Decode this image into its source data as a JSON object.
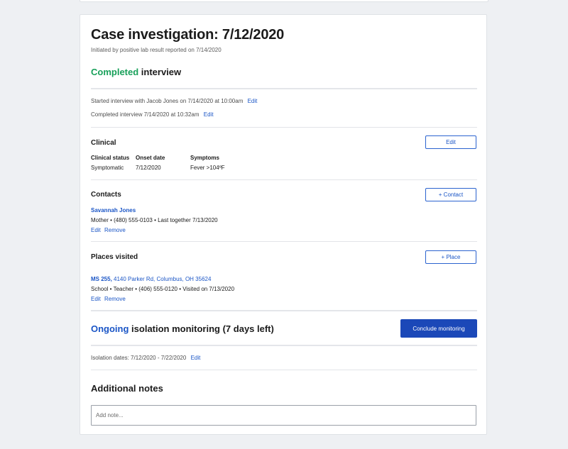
{
  "case": {
    "title": "Case investigation: 7/12/2020",
    "subtitle": "Initiated by positive lab result reported on 7/14/2020"
  },
  "interview": {
    "status_word": "Completed",
    "status_rest": " interview",
    "started_text": "Started interview with Jacob Jones on 7/14/2020 at 10:00am",
    "started_edit": "Edit",
    "completed_text": "Completed interview 7/14/2020 at 10:32am",
    "completed_edit": "Edit"
  },
  "clinical": {
    "heading": "Clinical",
    "edit_label": "Edit",
    "columns": [
      {
        "header": "Clinical status",
        "value": "Symptomatic"
      },
      {
        "header": "Onset date",
        "value": "7/12/2020"
      },
      {
        "header": "Symptoms",
        "value": "Fever >104ºF"
      }
    ]
  },
  "contacts": {
    "heading": "Contacts",
    "add_label": "+ Contact",
    "items": [
      {
        "name": "Savannah Jones",
        "details": "Mother • (480) 555-0103 • Last together 7/13/2020",
        "edit": "Edit",
        "remove": "Remove"
      }
    ]
  },
  "places": {
    "heading": "Places visited",
    "add_label": "+ Place",
    "items": [
      {
        "name": "MS 255,",
        "address": " 4140 Parker Rd, Columbus, OH 35624",
        "details": "School • Teacher • (406) 555-0120 • Visited on 7/13/2020",
        "edit": "Edit",
        "remove": "Remove"
      }
    ]
  },
  "monitoring": {
    "status_word": "Ongoing",
    "status_rest": " isolation monitoring (7 days left)",
    "conclude_label": "Conclude monitoring",
    "dates_text": "Isolation dates: 7/12/2020 - 7/22/2020",
    "dates_edit": "Edit"
  },
  "notes": {
    "heading": "Additional notes",
    "placeholder": "Add note..."
  },
  "colors": {
    "completed": "#18a05a",
    "ongoing": "#1a55c6",
    "primary_button": "#1b48b8",
    "link": "#1a55c6",
    "page_background": "#eef0f3"
  }
}
